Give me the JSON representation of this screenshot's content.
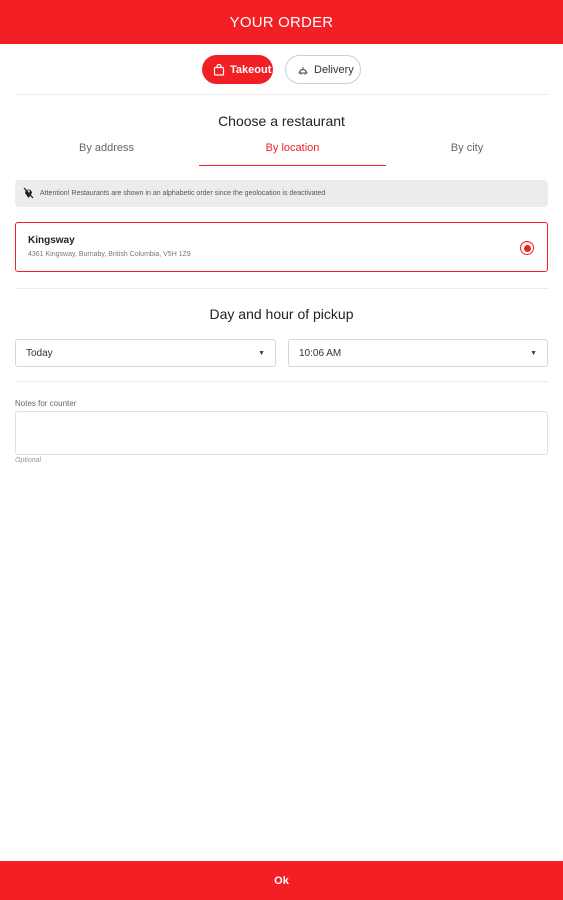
{
  "header": {
    "title": "YOUR ORDER"
  },
  "order_mode": {
    "takeout_label": "Takeout",
    "delivery_label": "Delivery",
    "selected": "Takeout"
  },
  "restaurant_section": {
    "title": "Choose a restaurant",
    "tabs": [
      {
        "label": "By address"
      },
      {
        "label": "By location"
      },
      {
        "label": "By city"
      }
    ],
    "active_tab": "By location",
    "notice": "Attention! Restaurants are shown in an alphabetic order since the geolocation is deactivated",
    "restaurants": [
      {
        "name": "Kingsway",
        "address": "4361 Kingsway, Burnaby, British Columbia, V5H 1Z9",
        "selected": true
      }
    ]
  },
  "pickup_section": {
    "title": "Day and hour of pickup",
    "day_value": "Today",
    "time_value": "10:06 AM"
  },
  "notes": {
    "label": "Notes for counter",
    "value": "",
    "hint": "Optional"
  },
  "footer": {
    "ok_label": "Ok"
  },
  "colors": {
    "accent": "#f21f24",
    "divider": "#ececec",
    "notice_bg": "#ececec"
  },
  "icons": {
    "takeout": "shopping-bag-icon",
    "delivery": "delivery-cloche-icon",
    "notice": "location-off-icon",
    "select_caret": "caret-down-icon"
  }
}
